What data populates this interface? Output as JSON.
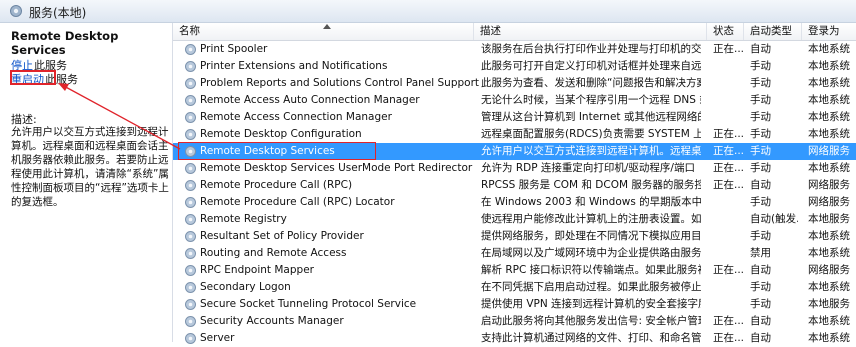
{
  "window": {
    "title": "服务(本地)"
  },
  "left_pane": {
    "service_name": "Remote Desktop Services",
    "stop_link": "停止",
    "stop_suffix": "此服务",
    "restart_link": "重启动",
    "restart_suffix": "此服务",
    "description_label": "描述:",
    "description_text": "允许用户以交互方式连接到远程计算机。远程桌面和远程桌面会话主机服务器依赖此服务。若要防止远程使用此计算机，请清除“系统”属性控制面板项目的“远程”选项卡上的复选框。"
  },
  "columns": {
    "name": "名称",
    "description": "描述",
    "status": "状态",
    "startup_type": "启动类型",
    "logon_as": "登录为"
  },
  "services": [
    {
      "name": "Print Spooler",
      "description": "该服务在后台执行打印作业并处理与打印机的交互...",
      "status": "正在...",
      "startup": "自动",
      "logon": "本地系统"
    },
    {
      "name": "Printer Extensions and Notifications",
      "description": "此服务可打开自定义打印机对话框并处理来自远程...",
      "status": "",
      "startup": "手动",
      "logon": "本地系统"
    },
    {
      "name": "Problem Reports and Solutions Control Panel Support",
      "description": "此服务为查看、发送和删除“问题报告和解决方案”...",
      "status": "",
      "startup": "手动",
      "logon": "本地系统"
    },
    {
      "name": "Remote Access Auto Connection Manager",
      "description": "无论什么时候，当某个程序引用一个远程 DNS 或...",
      "status": "",
      "startup": "手动",
      "logon": "本地系统"
    },
    {
      "name": "Remote Access Connection Manager",
      "description": "管理从这台计算机到 Internet 或其他远程网络的...",
      "status": "",
      "startup": "手动",
      "logon": "本地系统"
    },
    {
      "name": "Remote Desktop Configuration",
      "description": "远程桌面配置服务(RDCS)负责需要 SYSTEM 上下...",
      "status": "正在...",
      "startup": "手动",
      "logon": "本地系统"
    },
    {
      "name": "Remote Desktop Services",
      "description": "允许用户以交互方式连接到远程计算机。远程桌面...",
      "status": "正在...",
      "startup": "手动",
      "logon": "网络服务",
      "selected": true
    },
    {
      "name": "Remote Desktop Services UserMode Port Redirector",
      "description": "允许为 RDP 连接重定向打印机/驱动程序/端口",
      "status": "正在...",
      "startup": "手动",
      "logon": "本地系统"
    },
    {
      "name": "Remote Procedure Call (RPC)",
      "description": "RPCSS 服务是 COM 和 DCOM 服务器的服务控...",
      "status": "正在...",
      "startup": "自动",
      "logon": "网络服务"
    },
    {
      "name": "Remote Procedure Call (RPC) Locator",
      "description": "在 Windows 2003 和 Windows 的早期版本中，...",
      "status": "",
      "startup": "手动",
      "logon": "网络服务"
    },
    {
      "name": "Remote Registry",
      "description": "使远程用户能修改此计算机上的注册表设置。如果...",
      "status": "",
      "startup": "自动(触发...",
      "logon": "本地服务"
    },
    {
      "name": "Resultant Set of Policy Provider",
      "description": "提供网络服务，即处理在不同情况下模拟应用目标...",
      "status": "",
      "startup": "手动",
      "logon": "本地系统"
    },
    {
      "name": "Routing and Remote Access",
      "description": "在局域网以及广域网环境中为企业提供路由服务。",
      "status": "",
      "startup": "禁用",
      "logon": "本地系统"
    },
    {
      "name": "RPC Endpoint Mapper",
      "description": "解析 RPC 接口标识符以传输端点。如果此服务被...",
      "status": "正在...",
      "startup": "自动",
      "logon": "网络服务"
    },
    {
      "name": "Secondary Logon",
      "description": "在不同凭据下启用启动过程。如果此服务被停止，...",
      "status": "",
      "startup": "手动",
      "logon": "本地系统"
    },
    {
      "name": "Secure Socket Tunneling Protocol Service",
      "description": "提供使用 VPN 连接到远程计算机的安全套接字层...",
      "status": "",
      "startup": "手动",
      "logon": "本地服务"
    },
    {
      "name": "Security Accounts Manager",
      "description": "启动此服务将向其他服务发出信号: 安全帐户管理...",
      "status": "正在...",
      "startup": "自动",
      "logon": "本地系统"
    },
    {
      "name": "Server",
      "description": "支持此计算机通过网络的文件、打印、和命名管道...",
      "status": "正在...",
      "startup": "自动",
      "logon": "本地系统"
    }
  ],
  "colors": {
    "selection": "#3399ff",
    "annotation": "#e0242b",
    "link": "#0a52c9"
  }
}
